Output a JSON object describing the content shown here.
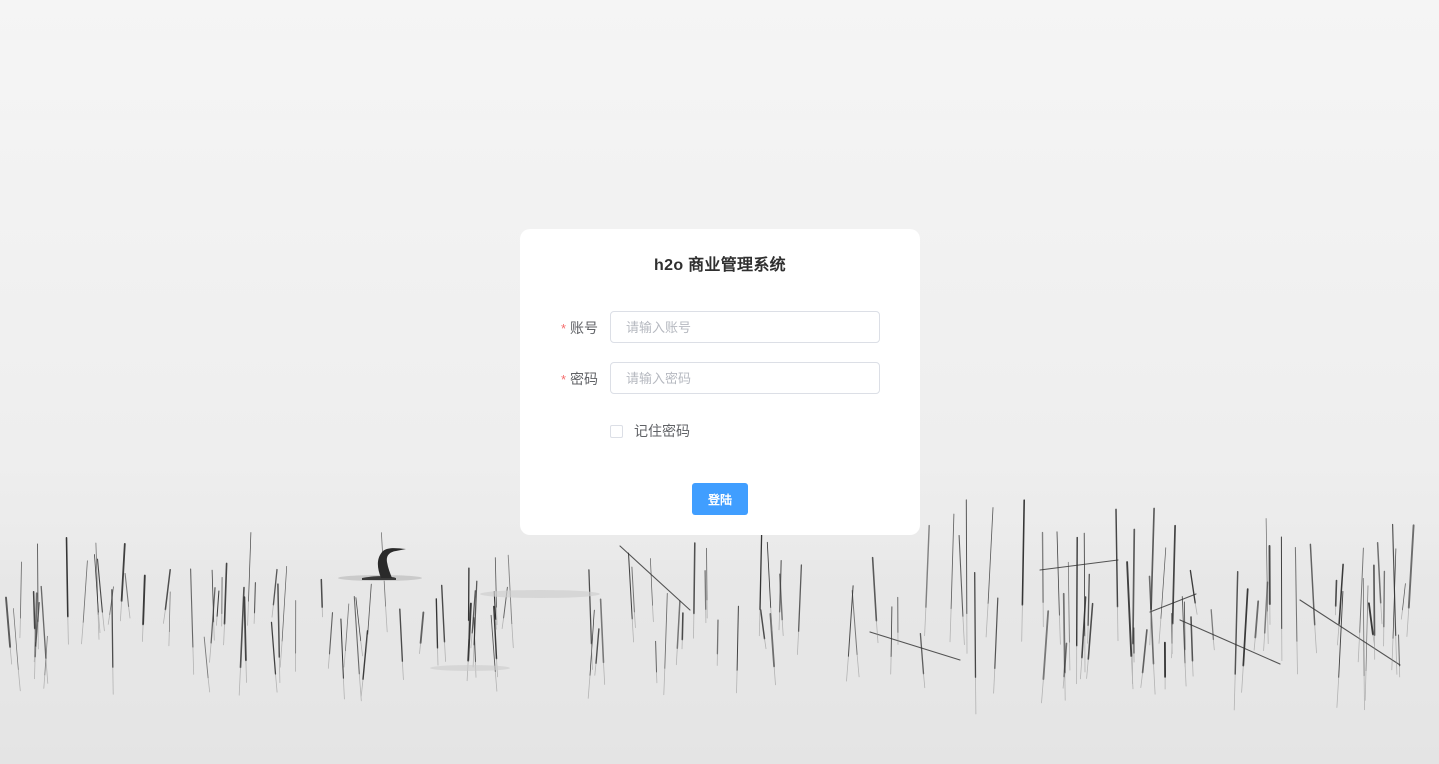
{
  "login": {
    "title": "h2o 商业管理系统",
    "account": {
      "label": "账号",
      "required_mark": "*",
      "placeholder": "请输入账号",
      "value": ""
    },
    "password": {
      "label": "密码",
      "required_mark": "*",
      "placeholder": "请输入密码",
      "value": ""
    },
    "remember": {
      "label": "记住密码",
      "checked": false
    },
    "submit_label": "登陆"
  },
  "theme": {
    "accent": "#409eff",
    "required": "#f56c6c",
    "card": "#ffffff",
    "text": "#606266"
  }
}
